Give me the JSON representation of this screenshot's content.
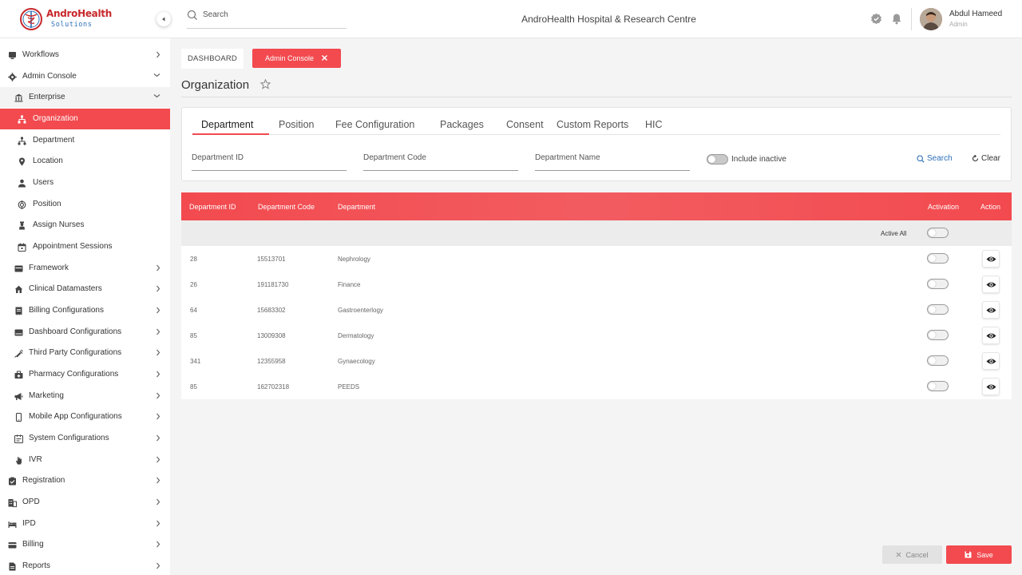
{
  "header": {
    "logo_line1": "AndroHealth",
    "logo_line2": "Solutions",
    "search_placeholder": "Search",
    "hospital_name": "AndroHealth Hospital & Research Centre",
    "user_name": "Abdul Hameed",
    "user_role": "Admin"
  },
  "sidebar": {
    "items": [
      {
        "label": "Workflows",
        "icon": "monitor-icon"
      },
      {
        "label": "Admin Console",
        "icon": "gear-icon"
      },
      {
        "label": "Enterprise",
        "icon": "bank-icon"
      },
      {
        "label": "Organization",
        "icon": "org-chart-icon"
      },
      {
        "label": "Department",
        "icon": "hierarchy-icon"
      },
      {
        "label": "Location",
        "icon": "location-pin-icon"
      },
      {
        "label": "Users",
        "icon": "user-icon"
      },
      {
        "label": "Position",
        "icon": "target-icon"
      },
      {
        "label": "Assign Nurses",
        "icon": "nurse-icon"
      },
      {
        "label": "Appointment Sessions",
        "icon": "calendar-icon"
      },
      {
        "label": "Framework",
        "icon": "frame-icon"
      },
      {
        "label": "Clinical Datamasters",
        "icon": "home-icon"
      },
      {
        "label": "Billing Configurations",
        "icon": "receipt-icon"
      },
      {
        "label": "Dashboard Configurations",
        "icon": "dashboard-icon"
      },
      {
        "label": "Third Party Configurations",
        "icon": "syringe-icon"
      },
      {
        "label": "Pharmacy Configurations",
        "icon": "briefcase-icon"
      },
      {
        "label": "Marketing",
        "icon": "megaphone-icon"
      },
      {
        "label": "Mobile App Configurations",
        "icon": "mobile-icon"
      },
      {
        "label": "System Configurations",
        "icon": "server-icon"
      },
      {
        "label": "IVR",
        "icon": "hand-icon"
      },
      {
        "label": "Registration",
        "icon": "clipboard-icon"
      },
      {
        "label": "OPD",
        "icon": "building-icon"
      },
      {
        "label": "IPD",
        "icon": "bed-icon"
      },
      {
        "label": "Billing",
        "icon": "card-icon"
      },
      {
        "label": "Reports",
        "icon": "document-icon"
      }
    ]
  },
  "breadcrumb": {
    "dashboard": "DASHBOARD",
    "admin": "Admin Console"
  },
  "page": {
    "title": "Organization"
  },
  "tabs": [
    "Department",
    "Position",
    "Fee Configuration",
    "Packages",
    "Consent",
    "Custom Reports",
    "HIC"
  ],
  "filters": {
    "dept_id_placeholder": "Department ID",
    "dept_code_placeholder": "Department Code",
    "dept_name_placeholder": "Department Name",
    "include_inactive": "Include inactive",
    "search": "Search",
    "clear": "Clear"
  },
  "table": {
    "headers": {
      "id": "Department ID",
      "code": "Department Code",
      "name": "Department",
      "activation": "Activation",
      "action": "Action"
    },
    "active_all": "Active All",
    "rows": [
      {
        "id": "28",
        "code": "15513701",
        "name": "Nephrology"
      },
      {
        "id": "26",
        "code": "191181730",
        "name": "Finance"
      },
      {
        "id": "64",
        "code": "15683302",
        "name": "Gastroenterlogy"
      },
      {
        "id": "85",
        "code": "13009308",
        "name": "Dermatology"
      },
      {
        "id": "341",
        "code": "12355958",
        "name": "Gynaecology"
      },
      {
        "id": "85",
        "code": "162702318",
        "name": "PEEDS"
      }
    ]
  },
  "footer": {
    "cancel": "Cancel",
    "save": "Save"
  },
  "colors": {
    "accent": "#f24a4f",
    "link": "#2c6fb8"
  }
}
